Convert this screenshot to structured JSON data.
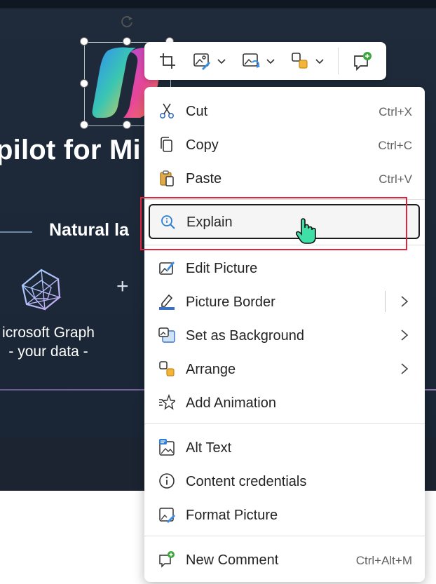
{
  "slide": {
    "title": "pilot for Mi",
    "subtitle": "Natural la",
    "graph_label_line1": "icrosoft Graph",
    "graph_label_line2": "- your data -",
    "plus": "+"
  },
  "mini_toolbar": {
    "buttons": [
      "crop",
      "picture-style",
      "change-picture",
      "arrange",
      "new-comment"
    ]
  },
  "context_menu": {
    "items": [
      {
        "label": "Cut",
        "shortcut": "Ctrl+X",
        "icon": "scissors-icon"
      },
      {
        "label": "Copy",
        "shortcut": "Ctrl+C",
        "icon": "copy-icon"
      },
      {
        "label": "Paste",
        "shortcut": "Ctrl+V",
        "icon": "paste-icon"
      },
      {
        "label": "Explain",
        "icon": "search-icon",
        "highlighted": true
      },
      {
        "label": "Edit Picture",
        "icon": "edit-picture-icon"
      },
      {
        "label": "Picture Border",
        "icon": "picture-border-icon",
        "submenu": true
      },
      {
        "label": "Set as Background",
        "icon": "set-background-icon",
        "submenu": true
      },
      {
        "label": "Arrange",
        "icon": "arrange-icon",
        "submenu": true
      },
      {
        "label": "Add Animation",
        "icon": "animation-star-icon"
      },
      {
        "label": "Alt Text",
        "icon": "alt-text-icon"
      },
      {
        "label": "Content credentials",
        "icon": "info-icon"
      },
      {
        "label": "Format Picture",
        "icon": "format-picture-icon"
      },
      {
        "label": "New Comment",
        "shortcut": "Ctrl+Alt+M",
        "icon": "new-comment-icon"
      }
    ]
  },
  "colors": {
    "slide_bg": "#1f2b3b",
    "highlight_red": "#e0263b",
    "menu_bg": "#ffffff"
  }
}
